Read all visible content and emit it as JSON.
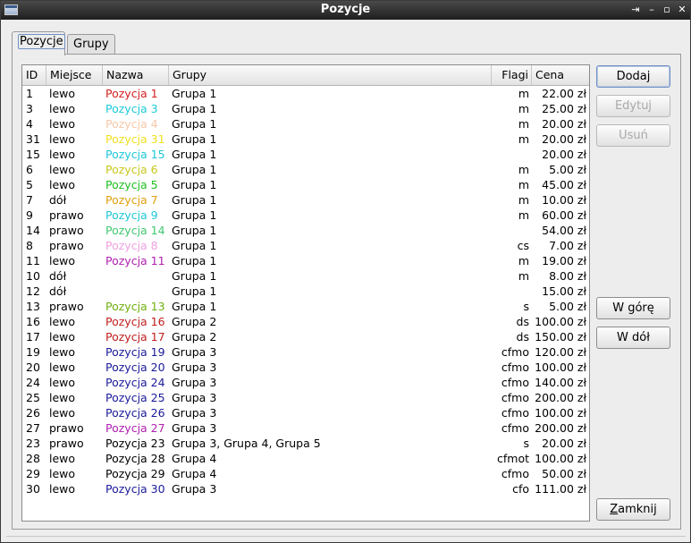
{
  "window": {
    "title": "Pozycje"
  },
  "tabs": [
    {
      "label": "Pozycje",
      "active": true
    },
    {
      "label": "Grupy",
      "active": false
    }
  ],
  "table": {
    "columns": [
      "ID",
      "Miejsce",
      "Nazwa",
      "Grupy",
      "Flagi",
      "Cena"
    ],
    "rows": [
      {
        "id": "1",
        "miejsce": "lewo",
        "nazwa": "Pozycja 1",
        "color": "#d42020",
        "grupy": "Grupa 1",
        "flagi": "m",
        "cena": "22.00 zł"
      },
      {
        "id": "3",
        "miejsce": "lewo",
        "nazwa": "Pozycja 3",
        "color": "#1ec8d8",
        "grupy": "Grupa 1",
        "flagi": "m",
        "cena": "25.00 zł"
      },
      {
        "id": "4",
        "miejsce": "lewo",
        "nazwa": "Pozycja 4",
        "color": "#f5c8a8",
        "grupy": "Grupa 1",
        "flagi": "m",
        "cena": "20.00 zł"
      },
      {
        "id": "31",
        "miejsce": "lewo",
        "nazwa": "Pozycja 31",
        "color": "#f0e020",
        "grupy": "Grupa 1",
        "flagi": "m",
        "cena": "20.00 zł"
      },
      {
        "id": "15",
        "miejsce": "lewo",
        "nazwa": "Pozycja 15",
        "color": "#1ec8d8",
        "grupy": "Grupa 1",
        "flagi": "",
        "cena": "20.00 zł"
      },
      {
        "id": "6",
        "miejsce": "lewo",
        "nazwa": "Pozycja 6",
        "color": "#c8c81e",
        "grupy": "Grupa 1",
        "flagi": "m",
        "cena": "5.00 zł"
      },
      {
        "id": "5",
        "miejsce": "lewo",
        "nazwa": "Pozycja 5",
        "color": "#20c020",
        "grupy": "Grupa 1",
        "flagi": "m",
        "cena": "45.00 zł"
      },
      {
        "id": "7",
        "miejsce": "dół",
        "nazwa": "Pozycja 7",
        "color": "#e0a010",
        "grupy": "Grupa 1",
        "flagi": "m",
        "cena": "10.00 zł"
      },
      {
        "id": "9",
        "miejsce": "prawo",
        "nazwa": "Pozycja 9",
        "color": "#1ec8d8",
        "grupy": "Grupa 1",
        "flagi": "m",
        "cena": "60.00 zł"
      },
      {
        "id": "14",
        "miejsce": "prawo",
        "nazwa": "Pozycja 14",
        "color": "#40c870",
        "grupy": "Grupa 1",
        "flagi": "",
        "cena": "54.00 zł"
      },
      {
        "id": "8",
        "miejsce": "prawo",
        "nazwa": "Pozycja 8",
        "color": "#f0a0e0",
        "grupy": "Grupa 1",
        "flagi": "cs",
        "cena": "7.00 zł"
      },
      {
        "id": "11",
        "miejsce": "lewo",
        "nazwa": "Pozycja 11",
        "color": "#b020b0",
        "grupy": "Grupa 1",
        "flagi": "m",
        "cena": "19.00 zł"
      },
      {
        "id": "10",
        "miejsce": "dół",
        "nazwa": "",
        "color": "#000000",
        "grupy": "Grupa 1",
        "flagi": "m",
        "cena": "8.00 zł"
      },
      {
        "id": "12",
        "miejsce": "dół",
        "nazwa": "",
        "color": "#000000",
        "grupy": "Grupa 1",
        "flagi": "",
        "cena": "15.00 zł"
      },
      {
        "id": "13",
        "miejsce": "prawo",
        "nazwa": "Pozycja 13",
        "color": "#70b010",
        "grupy": "Grupa 1",
        "flagi": "s",
        "cena": "5.00 zł"
      },
      {
        "id": "16",
        "miejsce": "lewo",
        "nazwa": "Pozycja 16",
        "color": "#c02020",
        "grupy": "Grupa 2",
        "flagi": "ds",
        "cena": "100.00 zł"
      },
      {
        "id": "17",
        "miejsce": "lewo",
        "nazwa": "Pozycja 17",
        "color": "#c02020",
        "grupy": "Grupa 2",
        "flagi": "ds",
        "cena": "150.00 zł"
      },
      {
        "id": "19",
        "miejsce": "lewo",
        "nazwa": "Pozycja 19",
        "color": "#1a1a9a",
        "grupy": "Grupa 3",
        "flagi": "cfmo",
        "cena": "120.00 zł"
      },
      {
        "id": "20",
        "miejsce": "lewo",
        "nazwa": "Pozycja 20",
        "color": "#1a1a9a",
        "grupy": "Grupa 3",
        "flagi": "cfmo",
        "cena": "100.00 zł"
      },
      {
        "id": "24",
        "miejsce": "lewo",
        "nazwa": "Pozycja 24",
        "color": "#1a1a9a",
        "grupy": "Grupa 3",
        "flagi": "cfmo",
        "cena": "140.00 zł"
      },
      {
        "id": "25",
        "miejsce": "lewo",
        "nazwa": "Pozycja 25",
        "color": "#1a1a9a",
        "grupy": "Grupa 3",
        "flagi": "cfmo",
        "cena": "200.00 zł"
      },
      {
        "id": "26",
        "miejsce": "lewo",
        "nazwa": "Pozycja 26",
        "color": "#1a1a9a",
        "grupy": "Grupa 3",
        "flagi": "cfmo",
        "cena": "100.00 zł"
      },
      {
        "id": "27",
        "miejsce": "prawo",
        "nazwa": "Pozycja 27",
        "color": "#b020b0",
        "grupy": "Grupa 3",
        "flagi": "cfmo",
        "cena": "200.00 zł"
      },
      {
        "id": "23",
        "miejsce": "prawo",
        "nazwa": "Pozycja 23",
        "color": "#000000",
        "grupy": "Grupa 3, Grupa 4, Grupa 5",
        "flagi": "s",
        "cena": "20.00 zł"
      },
      {
        "id": "28",
        "miejsce": "lewo",
        "nazwa": "Pozycja 28",
        "color": "#000000",
        "grupy": "Grupa 4",
        "flagi": "cfmot",
        "cena": "100.00 zł"
      },
      {
        "id": "29",
        "miejsce": "lewo",
        "nazwa": "Pozycja 29",
        "color": "#000000",
        "grupy": "Grupa 4",
        "flagi": "cfmo",
        "cena": "50.00 zł"
      },
      {
        "id": "30",
        "miejsce": "lewo",
        "nazwa": "Pozycja 30",
        "color": "#1a1a9a",
        "grupy": "Grupa 3",
        "flagi": "cfo",
        "cena": "111.00 zł"
      }
    ]
  },
  "buttons": {
    "add": "Dodaj",
    "edit": "Edytuj",
    "remove": "Usuń",
    "up": "W górę",
    "down": "W dół",
    "close_prefix": "Z",
    "close_rest": "amknij"
  }
}
